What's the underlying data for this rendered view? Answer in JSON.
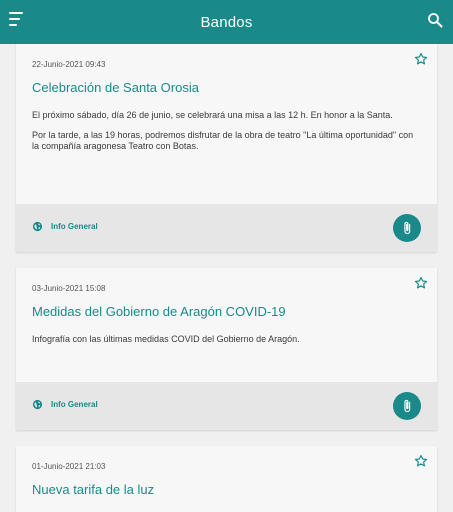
{
  "appbar": {
    "title": "Bandos",
    "menu_icon": "menu-icon",
    "search_icon": "search-icon"
  },
  "colors": {
    "primary": "#19898a",
    "background": "#f0f0f0",
    "card": "#f7f7f7",
    "card_footer": "#e6e6e6"
  },
  "cards": [
    {
      "date": "22-Junio-2021 09:43",
      "title": "Celebración de Santa Orosia",
      "paragraphs": [
        "El próximo sábado, día 26 de junio, se celebrará una misa a las 12 h. En honor a la Santa.",
        "Por la tarde, a las 19 horas, podremos disfrutar de la obra de teatro \"La última oportunidad\" con la compañía aragonesa Teatro con Botas."
      ],
      "category": "Info General"
    },
    {
      "date": "03-Junio-2021 15:08",
      "title": "Medidas del Gobierno de Aragón COVID-19",
      "paragraphs": [
        "Infografía con las últimas medidas COVID del Gobierno de Aragón."
      ],
      "category": "Info General"
    },
    {
      "date": "01-Junio-2021 21:03",
      "title": "Nueva tarifa de la luz"
    }
  ]
}
